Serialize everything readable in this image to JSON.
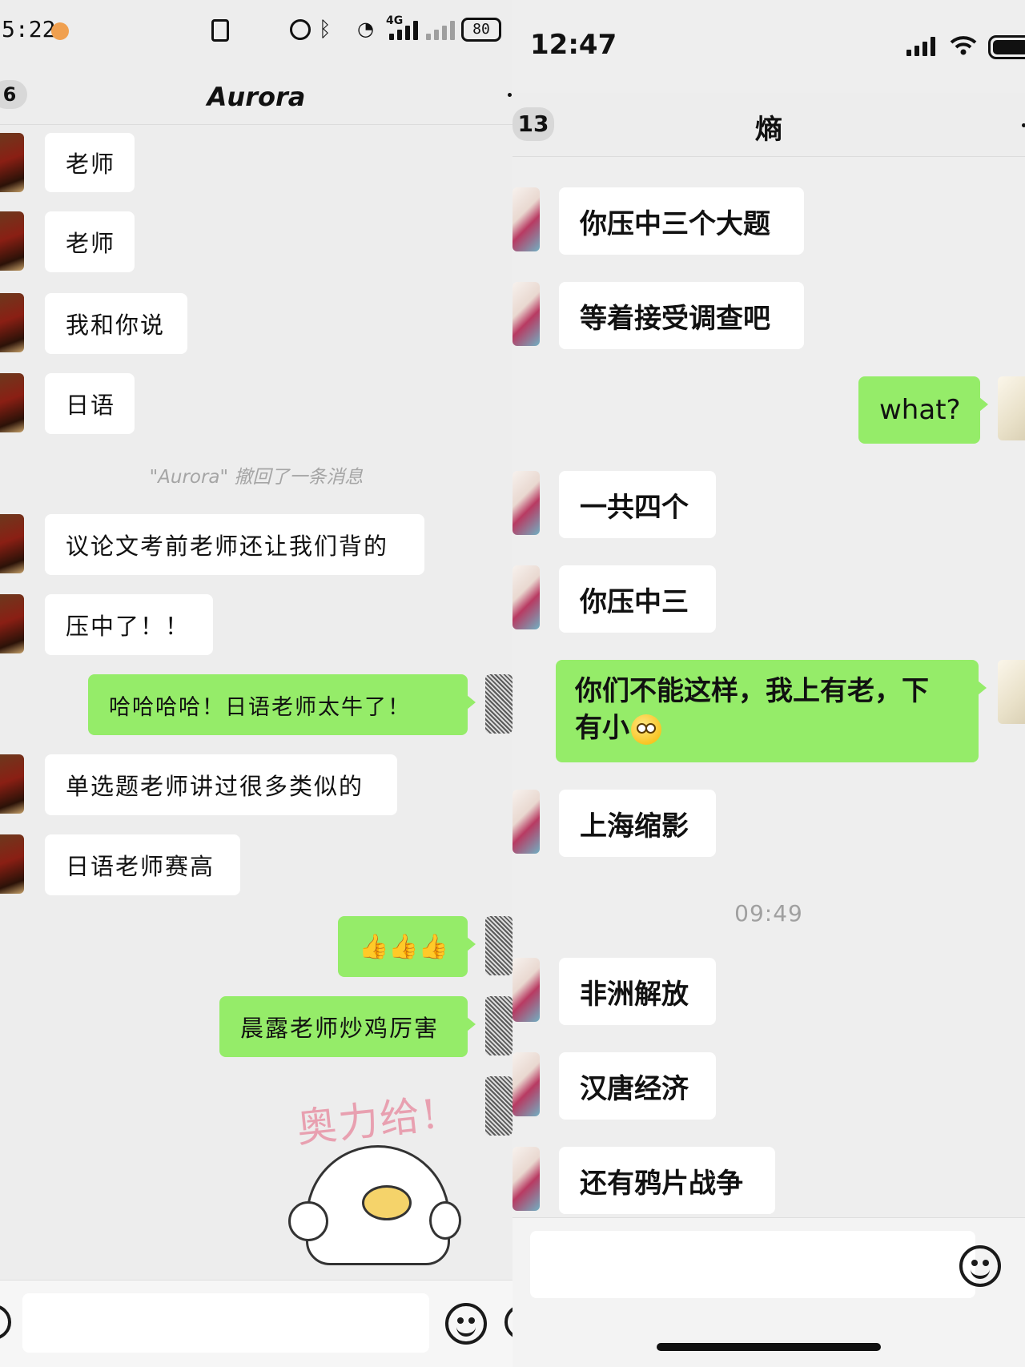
{
  "left": {
    "status": {
      "time": "5:22",
      "battery": "80",
      "network": "4G",
      "icons": [
        "nfc-icon",
        "alarm-icon",
        "bluetooth-icon",
        "wifi-icon",
        "signal-icon",
        "battery-icon"
      ]
    },
    "nav": {
      "back_badge": "6",
      "title": "Aurora"
    },
    "messages": [
      {
        "side": "in",
        "text": "老师"
      },
      {
        "side": "in",
        "text": "老师"
      },
      {
        "side": "in",
        "text": "我和你说"
      },
      {
        "side": "in",
        "text": "日语"
      },
      {
        "side": "system",
        "text": "\"Aurora\" 撤回了一条消息"
      },
      {
        "side": "in",
        "text": "议论文考前老师还让我们背的"
      },
      {
        "side": "in",
        "text": "压中了！！"
      },
      {
        "side": "out",
        "text": "哈哈哈哈！日语老师太牛了！"
      },
      {
        "side": "in",
        "text": "单选题老师讲过很多类似的"
      },
      {
        "side": "in",
        "text": "日语老师赛高"
      },
      {
        "side": "out",
        "text": "👍👍👍"
      },
      {
        "side": "out",
        "text": "晨露老师炒鸡厉害"
      },
      {
        "side": "out-sticker",
        "text": "奥力给!"
      }
    ]
  },
  "right": {
    "status": {
      "time": "12:47",
      "icons": [
        "signal-icon",
        "wifi-icon",
        "battery-icon"
      ]
    },
    "nav": {
      "back_badge": "13",
      "title": "熵"
    },
    "messages": [
      {
        "side": "in",
        "text": "你压中三个大题"
      },
      {
        "side": "in",
        "text": "等着接受调查吧"
      },
      {
        "side": "out",
        "text": "what?"
      },
      {
        "side": "in",
        "text": "一共四个"
      },
      {
        "side": "in",
        "text": "你压中三"
      },
      {
        "side": "out",
        "text_line1": "你们不能这样，我上有老，下",
        "text_line2": "有小"
      },
      {
        "side": "in",
        "text": "上海缩影"
      },
      {
        "side": "time",
        "text": "09:49"
      },
      {
        "side": "in",
        "text": "非洲解放"
      },
      {
        "side": "in",
        "text": "汉唐经济"
      },
      {
        "side": "in",
        "text": "还有鸦片战争"
      }
    ]
  },
  "colors": {
    "incoming_bubble": "#ffffff",
    "outgoing_bubble": "#95ec69",
    "background": "#ededed"
  }
}
